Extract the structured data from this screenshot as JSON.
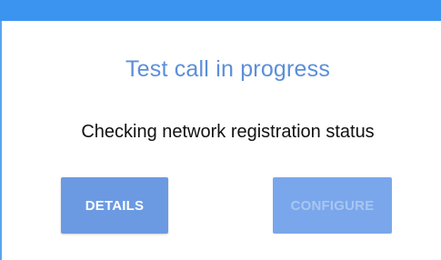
{
  "dialog": {
    "title": "Test call in progress",
    "message": "Checking network registration status",
    "buttons": {
      "details_label": "DETAILS",
      "configure_label": "CONFIGURE"
    }
  },
  "colors": {
    "top_bar": "#3b94f0",
    "title": "#5b8fd9",
    "details_button": "#6b9ae3",
    "configure_button": "#7aa7eb",
    "configure_text": "#a9c6f0"
  }
}
